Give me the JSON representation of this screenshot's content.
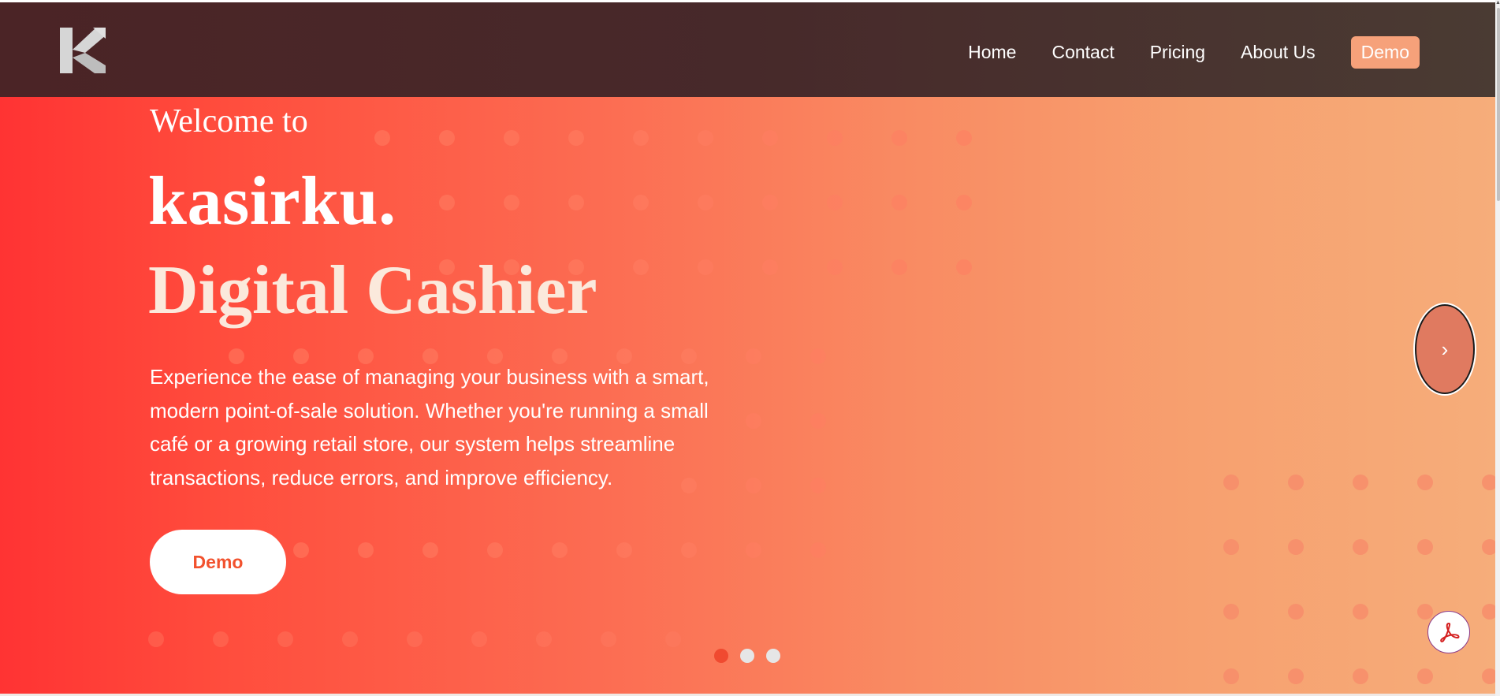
{
  "header": {
    "logo_icon": "kasirku-logo-icon",
    "nav": {
      "home": "Home",
      "contact": "Contact",
      "pricing": "Pricing",
      "about": "About Us",
      "demo": "Demo"
    }
  },
  "hero": {
    "welcome": "Welcome to",
    "brand": "kasirku.",
    "tagline": "Digital Cashier",
    "description": "Experience the ease of managing your business with a smart, modern point-of-sale solution. Whether you're running a small café or a growing retail store, our system helps streamline transactions, reduce errors, and improve efficiency.",
    "cta": "Demo"
  },
  "carousel": {
    "next_label": "›",
    "slide_count": 3,
    "active_slide": 1
  },
  "colors": {
    "header_bg": "#47292a",
    "hero_start": "#ff3333",
    "hero_end": "#f6ad7a",
    "accent": "#f6a17a",
    "cta_text": "#f2522e"
  },
  "floating": {
    "pdf_icon": "pdf-icon"
  }
}
